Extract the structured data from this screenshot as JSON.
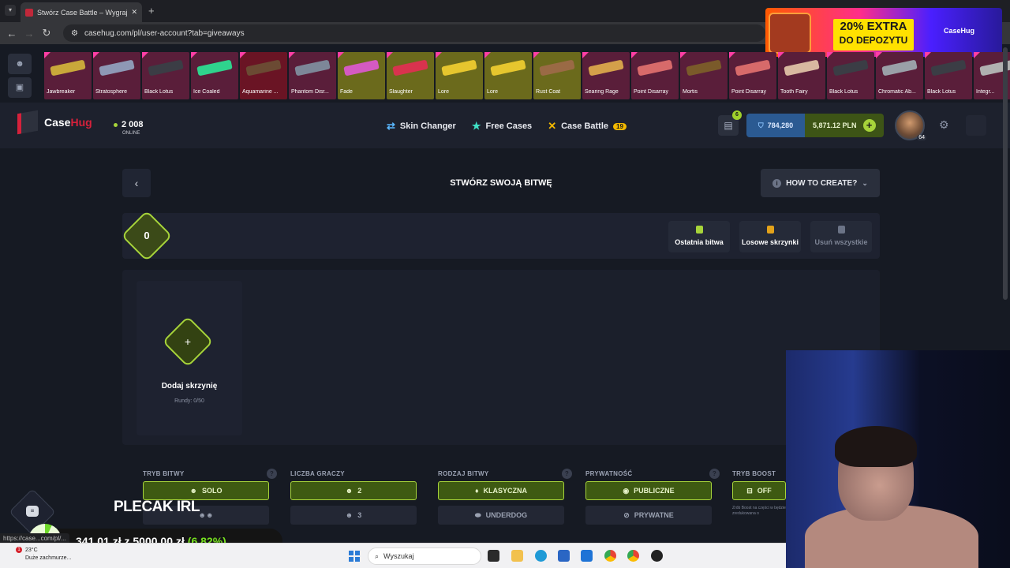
{
  "browser": {
    "tab_title": "Stwórz Case Battle – Wygraj sk",
    "url": "casehug.com/pl/user-account?tab=giveaways",
    "status_url": "https://case...com/pl/..."
  },
  "promo": {
    "line1": "20% EXTRA",
    "line2": "DO DEPOZYTU",
    "brand": "CaseHug"
  },
  "live_drops": [
    {
      "name": "Jawbreaker",
      "bg": "#5a1e3a",
      "gun": "#c9a83a"
    },
    {
      "name": "Stratosphere",
      "bg": "#5a1e3a",
      "gun": "#8e98b5"
    },
    {
      "name": "Black Lotus",
      "bg": "#5a1e3a",
      "gun": "#3b3d45"
    },
    {
      "name": "Ice Coaled",
      "bg": "#5a1e3a",
      "gun": "#2fd38d"
    },
    {
      "name": "Aquamarine ...",
      "bg": "#6a1424",
      "gun": "#6b4a33"
    },
    {
      "name": "Phantom Disr...",
      "bg": "#5a1e3a",
      "gun": "#7d8798"
    },
    {
      "name": "Fade",
      "bg": "#6b6a1c",
      "gun": "#d45ac2"
    },
    {
      "name": "Slaughter",
      "bg": "#6b6a1c",
      "gun": "#d9334e"
    },
    {
      "name": "Lore",
      "bg": "#6b6a1c",
      "gun": "#e6c62e"
    },
    {
      "name": "Lore",
      "bg": "#6b6a1c",
      "gun": "#e6c62e"
    },
    {
      "name": "Rust Coat",
      "bg": "#6b6a1c",
      "gun": "#9a6a45"
    },
    {
      "name": "Searing Rage",
      "bg": "#5a1e3a",
      "gun": "#d4a04a"
    },
    {
      "name": "Point Disarray",
      "bg": "#5a1e3a",
      "gun": "#d76a6a"
    },
    {
      "name": "Mortis",
      "bg": "#5a1e3a",
      "gun": "#7a5a2a"
    },
    {
      "name": "Point Disarray",
      "bg": "#5a1e3a",
      "gun": "#d76a6a"
    },
    {
      "name": "Tooth Fairy",
      "bg": "#5a1e3a",
      "gun": "#d8b8a0"
    },
    {
      "name": "Black Lotus",
      "bg": "#5a1e3a",
      "gun": "#3b3d45"
    },
    {
      "name": "Chromatic Ab...",
      "bg": "#5a1e3a",
      "gun": "#9aa0a8"
    },
    {
      "name": "Black Lotus",
      "bg": "#5a1e3a",
      "gun": "#3b3d45"
    },
    {
      "name": "Integr...",
      "bg": "#5a1e3a",
      "gun": "#b0b0b0"
    }
  ],
  "header": {
    "logo_a": "Case",
    "logo_b": "Hug",
    "online_count": "2 008",
    "online_label": "ONLINE",
    "nav": [
      {
        "label": "Skin Changer",
        "icon": "swap-icon",
        "color": "#5ab7ff"
      },
      {
        "label": "Free Cases",
        "icon": "star-icon",
        "color": "#3fe0c5"
      },
      {
        "label": "Case Battle",
        "icon": "swords-icon",
        "color": "#f2b800",
        "badge": "19"
      }
    ],
    "gift_count": "6",
    "coins": "784,280",
    "balance": "5,871.12 PLN",
    "avatar_level": "64"
  },
  "page": {
    "title": "STWÓRZ SWOJĄ BITWĘ",
    "how_to": "HOW TO CREATE?",
    "cost": "0",
    "quick_actions": [
      {
        "label": "Ostatnia bitwa",
        "color": "#a7d43a",
        "enabled": true
      },
      {
        "label": "Losowe skrzynki",
        "color": "#e3a21a",
        "enabled": true
      },
      {
        "label": "Usuń wszystkie",
        "color": "#6b7386",
        "enabled": false
      }
    ],
    "add_case": {
      "label": "Dodaj skrzynię",
      "rounds": "Rundy: 0/50"
    }
  },
  "options": [
    {
      "title": "TRYB BITWY",
      "help": true,
      "items": [
        {
          "label": "SOLO",
          "active": true
        },
        {
          "label": "",
          "active": false
        }
      ]
    },
    {
      "title": "LICZBA GRACZY",
      "help": false,
      "items": [
        {
          "label": "2",
          "active": true
        },
        {
          "label": "3",
          "active": false
        }
      ]
    },
    {
      "title": "RODZAJ BITWY",
      "help": true,
      "items": [
        {
          "label": "KLASYCZNA",
          "active": true
        },
        {
          "label": "UNDERDOG",
          "active": false
        }
      ]
    },
    {
      "title": "PRYWATNOŚĆ",
      "help": true,
      "items": [
        {
          "label": "PUBLICZNE",
          "active": true
        },
        {
          "label": "PRYWATNE",
          "active": false
        }
      ]
    },
    {
      "title": "TRYB BOOST",
      "help": false,
      "items": [
        {
          "label": "OFF",
          "active": true
        }
      ]
    }
  ],
  "boost_note": "Zrób Boost na części w będzie zredukowana o",
  "overlay": {
    "title": "PLECAK IRL",
    "amount": "341,01 zł",
    "of": "z",
    "goal": "5000,00 zł",
    "percent": "(6.82%)",
    "progress": 0.0682
  },
  "taskbar": {
    "temp": "23°C",
    "weather": "Duże zachmurze...",
    "search": "Wyszukaj"
  }
}
